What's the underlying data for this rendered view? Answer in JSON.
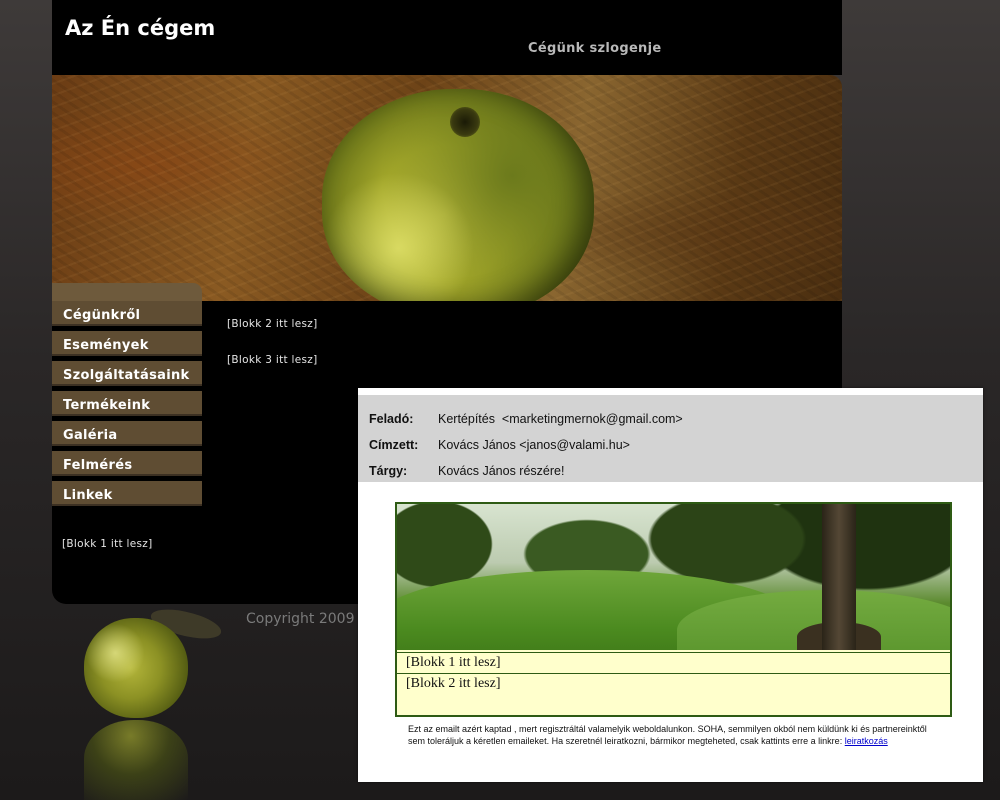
{
  "site": {
    "title": "Az Én cégem",
    "slogan": "Cégünk szlogenje",
    "menu": [
      {
        "label": "Cégünkről"
      },
      {
        "label": "Események"
      },
      {
        "label": "Szolgáltatásaink"
      },
      {
        "label": "Termékeink"
      },
      {
        "label": "Galéria"
      },
      {
        "label": "Felmérés"
      },
      {
        "label": "Linkek"
      }
    ],
    "blocks": {
      "block1": "[Blokk 1 itt lesz]",
      "block2": "[Blokk 2 itt lesz]",
      "block3": "[Blokk 3 itt lesz]"
    },
    "copyright": "Copyright 2009"
  },
  "email": {
    "from_label": "Feladó:",
    "from_value": "Kertépítés  <marketingmernok@gmail.com>",
    "to_label": "Címzett:",
    "to_value": "Kovács János <janos@valami.hu>",
    "subject_label": "Tárgy:",
    "subject_value": "Kovács János részére!",
    "newsletter": {
      "block1": "[Blokk 1 itt lesz]",
      "block2": "[Blokk 2 itt lesz]"
    },
    "disclaimer": "Ezt az emailt azért kaptad , mert regisztráltál valamelyik weboldalunkon. SOHA, semmilyen okból nem küldünk ki és partnereinktől sem toleráljuk a kéretlen emaileket. Ha szeretnél leiratkozni, bármikor megteheted, csak kattints erre a linkre:",
    "unsubscribe_link": "leiratkozás"
  },
  "colors": {
    "menu_item": "#5f4d33",
    "newsletter_border": "#2e5b14",
    "newsletter_bg": "#ffffcc",
    "email_header_bg": "#d3d3d3"
  }
}
